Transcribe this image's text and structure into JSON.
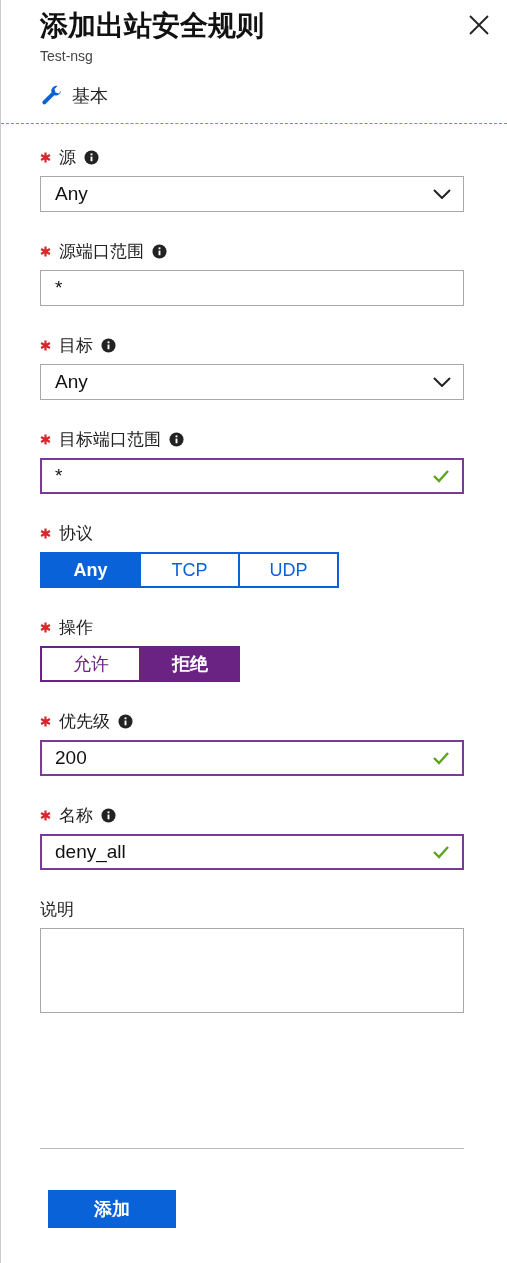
{
  "header": {
    "title": "添加出站安全规则",
    "subtitle": "Test-nsg",
    "section": "基本"
  },
  "fields": [
    {
      "kind": "dropdown",
      "label": "源",
      "required": true,
      "info": true,
      "value": "Any",
      "valid": false
    },
    {
      "kind": "text",
      "label": "源端口范围",
      "required": true,
      "info": true,
      "value": "*",
      "valid": false
    },
    {
      "kind": "dropdown",
      "label": "目标",
      "required": true,
      "info": true,
      "value": "Any",
      "valid": false
    },
    {
      "kind": "text",
      "label": "目标端口范围",
      "required": true,
      "info": true,
      "value": "*",
      "valid": true
    },
    {
      "kind": "segmented",
      "label": "协议",
      "required": true,
      "info": false,
      "color": "#0a62d9",
      "options": [
        {
          "label": "Any",
          "selected": true
        },
        {
          "label": "TCP",
          "selected": false
        },
        {
          "label": "UDP",
          "selected": false
        }
      ]
    },
    {
      "kind": "segmented",
      "label": "操作",
      "required": true,
      "info": false,
      "color": "#6b2383",
      "options": [
        {
          "label": "允许",
          "selected": false
        },
        {
          "label": "拒绝",
          "selected": true
        }
      ]
    },
    {
      "kind": "text",
      "label": "优先级",
      "required": true,
      "info": true,
      "value": "200",
      "valid": true
    },
    {
      "kind": "text",
      "label": "名称",
      "required": true,
      "info": true,
      "value": "deny_all",
      "valid": true
    },
    {
      "kind": "textarea",
      "label": "说明",
      "required": false,
      "info": false,
      "valid": false
    }
  ],
  "submit": "添加"
}
